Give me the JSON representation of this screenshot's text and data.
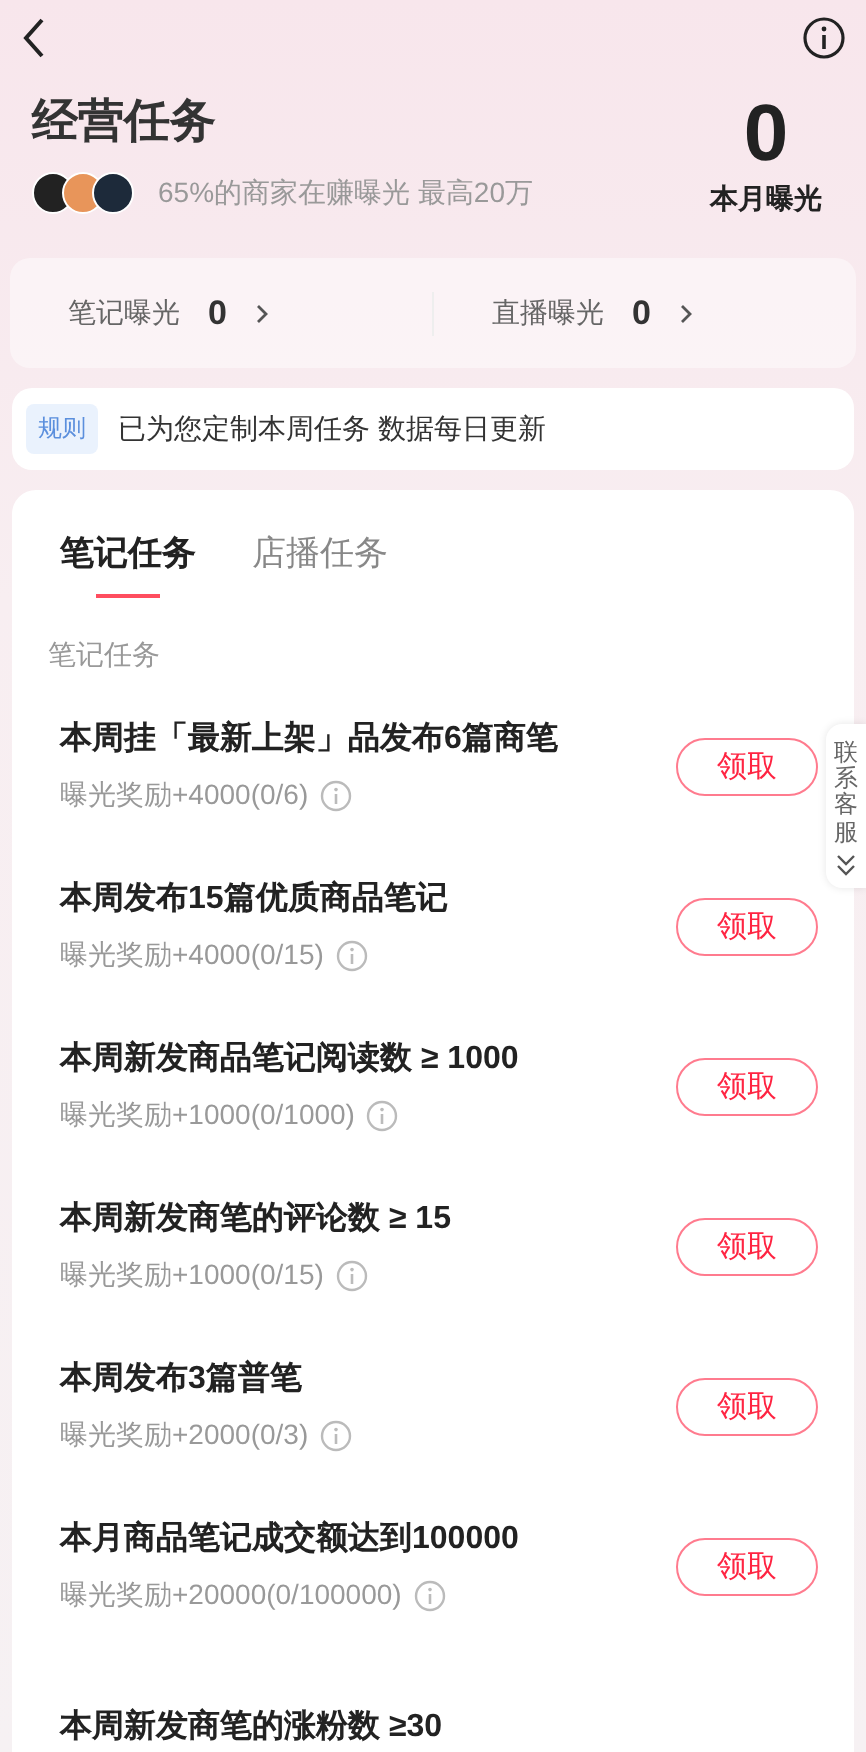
{
  "header": {
    "title": "经营任务",
    "subtitle": "65%的商家在赚曝光 最高20万",
    "month_value": "0",
    "month_label": "本月曝光"
  },
  "stats": [
    {
      "label": "笔记曝光",
      "value": "0"
    },
    {
      "label": "直播曝光",
      "value": "0"
    }
  ],
  "notice": {
    "tag": "规则",
    "text": "已为您定制本周任务 数据每日更新"
  },
  "tabs": [
    {
      "label": "笔记任务",
      "selected": true
    },
    {
      "label": "店播任务",
      "selected": false
    }
  ],
  "section_title": "笔记任务",
  "tasks": [
    {
      "title": "本周挂「最新上架」品发布6篇商笔",
      "reward": "曝光奖励+4000(0/6)",
      "button": "领取"
    },
    {
      "title": "本周发布15篇优质商品笔记",
      "reward": "曝光奖励+4000(0/15)",
      "button": "领取"
    },
    {
      "title": "本周新发商品笔记阅读数 ≥ 1000",
      "reward": "曝光奖励+1000(0/1000)",
      "button": "领取"
    },
    {
      "title": "本周新发商笔的评论数 ≥ 15",
      "reward": "曝光奖励+1000(0/15)",
      "button": "领取"
    },
    {
      "title": "本周发布3篇普笔",
      "reward": "曝光奖励+2000(0/3)",
      "button": "领取"
    },
    {
      "title": "本月商品笔记成交额达到100000",
      "reward": "曝光奖励+20000(0/100000)",
      "button": "领取"
    },
    {
      "title": "本周新发商笔的涨粉数 ≥30"
    }
  ],
  "side_tab": {
    "label": "联系客服"
  }
}
